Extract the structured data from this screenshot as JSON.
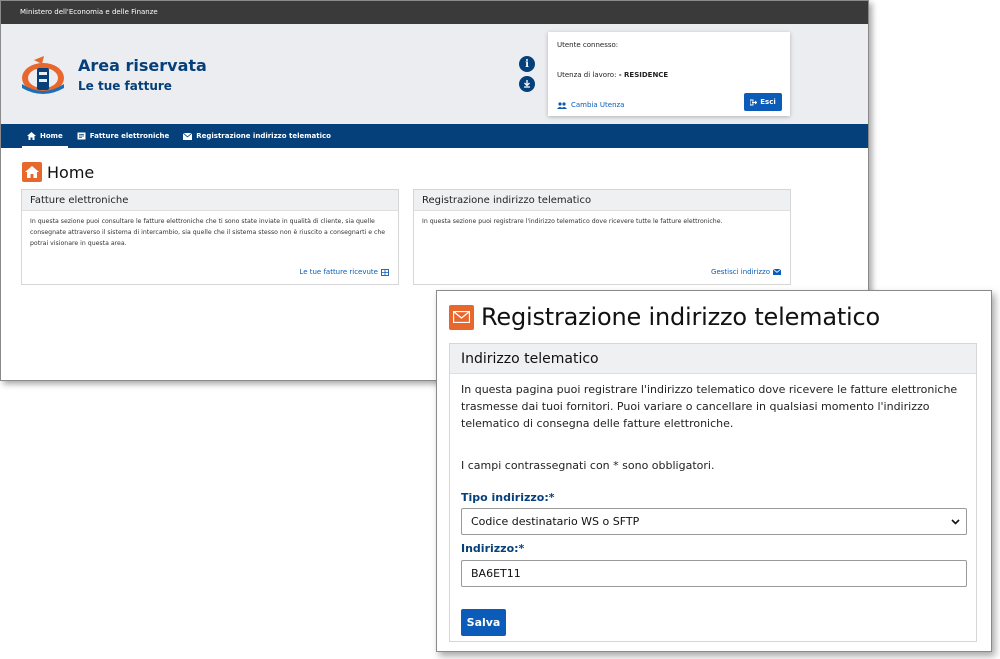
{
  "back": {
    "ministry": "Ministero dell'Economia e delle Finanze",
    "title": "Area riservata",
    "subtitle": "Le tue fatture",
    "user_box": {
      "connected_label": "Utente connesso:",
      "work_label": "Utenza di lavoro:",
      "work_value": "- RESIDENCE",
      "change_user": "Cambia Utenza",
      "exit": "Esci"
    },
    "nav": [
      {
        "label": "Home",
        "icon": "home-icon"
      },
      {
        "label": "Fatture elettroniche",
        "icon": "invoice-icon"
      },
      {
        "label": "Registrazione indirizzo telematico",
        "icon": "mail-icon"
      }
    ],
    "page_title": "Home",
    "cards": [
      {
        "title": "Fatture elettroniche",
        "body": "In questa sezione puoi consultare le fatture elettroniche che ti sono state inviate in qualità di cliente, sia quelle consegnate attraverso il sistema di intercambio, sia quelle che il sistema stesso non è riuscito a consegnarti e che potrai visionare in questa area.",
        "link": "Le tue fatture ricevute"
      },
      {
        "title": "Registrazione indirizzo telematico",
        "body": "In questa sezione puoi registrare l'indirizzo telematico dove ricevere tutte le fatture elettroniche.",
        "link": "Gestisci indirizzo"
      }
    ]
  },
  "front": {
    "title": "Registrazione indirizzo telematico",
    "card_title": "Indirizzo telematico",
    "description": "In questa pagina puoi registrare l'indirizzo telematico dove ricevere le fatture elettroniche trasmesse dai tuoi fornitori. Puoi variare o cancellare in qualsiasi momento l'indirizzo telematico di consegna delle fatture elettroniche.",
    "required_note": "I campi contrassegnati con * sono obbligatori.",
    "tipo_label": "Tipo indirizzo:*",
    "tipo_value": "Codice destinatario WS o SFTP",
    "indirizzo_label": "Indirizzo:*",
    "indirizzo_value": "BA6ET11",
    "save": "Salva"
  },
  "colors": {
    "brand_blue": "#06407a",
    "link_blue": "#0a5cb8",
    "accent_orange": "#e8672c",
    "top_bar": "#3a3a3a"
  }
}
